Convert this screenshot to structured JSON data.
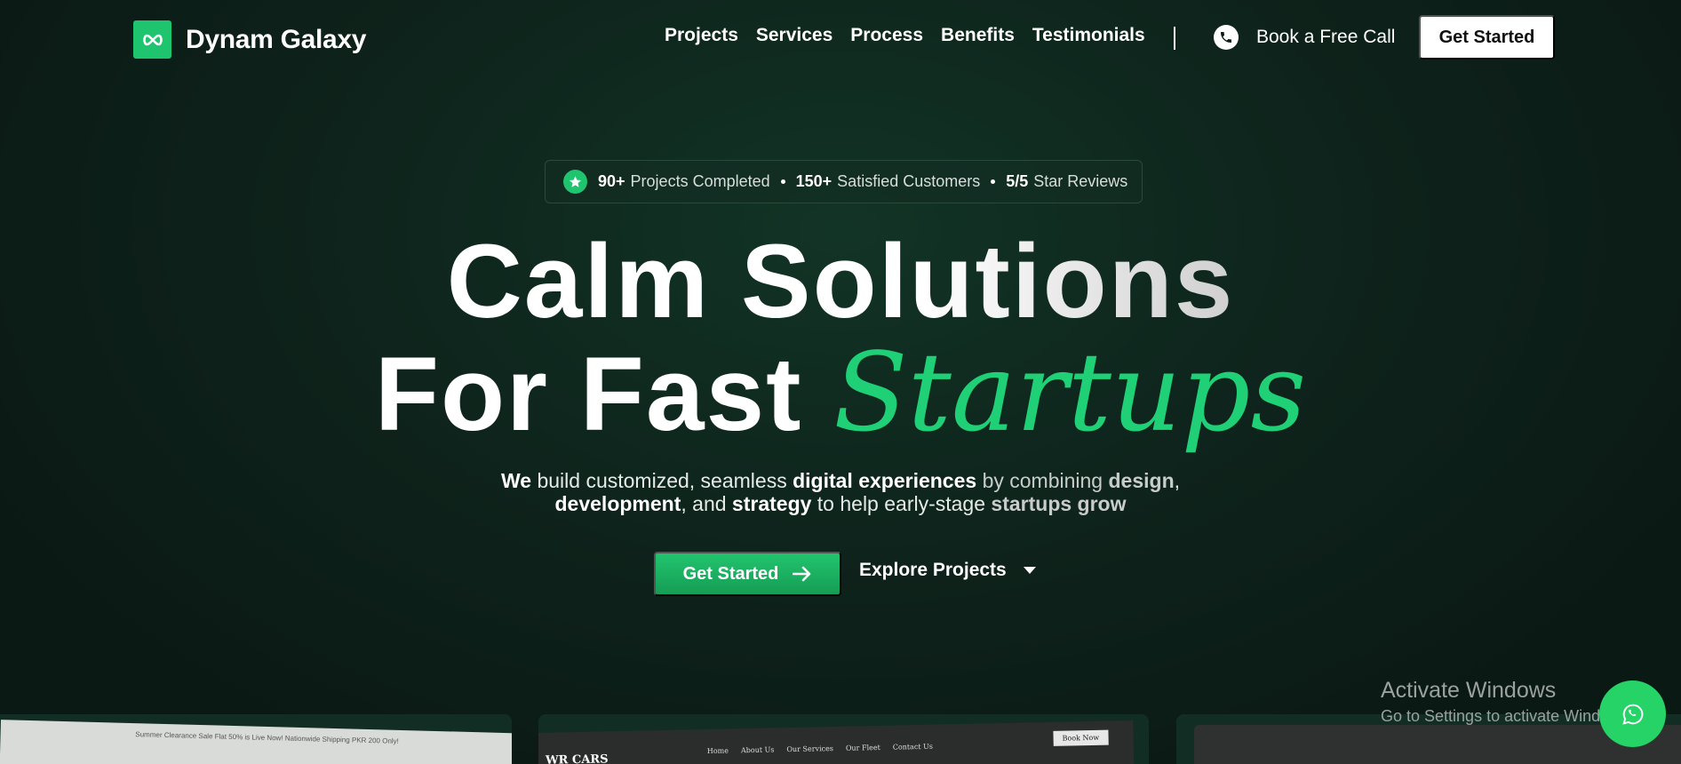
{
  "brand": {
    "name": "Dynam Galaxy",
    "logo_icon": "infinity-icon",
    "accent_color": "#1fc46f"
  },
  "nav": {
    "items": [
      {
        "label": "Projects"
      },
      {
        "label": "Services"
      },
      {
        "label": "Process"
      },
      {
        "label": "Benefits"
      },
      {
        "label": "Testimonials"
      }
    ],
    "call_label": "Book a Free Call",
    "call_icon": "phone-icon",
    "cta_label": "Get Started"
  },
  "stats": {
    "icon": "star-icon",
    "items": [
      {
        "num": "90+",
        "text": "Projects Completed"
      },
      {
        "num": "150+",
        "text": "Satisfied Customers"
      },
      {
        "num": "5/5",
        "text": "Star Reviews"
      }
    ]
  },
  "hero": {
    "line1": "Calm Solutions",
    "line2_plain": "For Fast ",
    "line2_accent": "Startups",
    "sub": {
      "p1_b": "We",
      "p1": " build customized, seamless ",
      "p2_b": "digital experiences",
      "p2": " by combining ",
      "p3_b": "design",
      "p3": ",",
      "p4_b": "development",
      "p4": ", and ",
      "p5_b": "strategy",
      "p5": " to help early-stage ",
      "p6_b": "startups grow"
    },
    "primary_cta": "Get Started",
    "secondary_cta": "Explore Projects"
  },
  "previews": {
    "card1_banner": "Summer Clearance Sale Flat 50% is Live Now! Nationwide Shipping PKR 200 Only!",
    "card2": {
      "brand": "WR CARS",
      "links": [
        "Home",
        "About Us",
        "Our Services",
        "Our Fleet",
        "Contact Us"
      ],
      "book": "Book Now"
    }
  },
  "watermark": {
    "title": "Activate Windows",
    "sub": "Go to Settings to activate Windows."
  },
  "whatsapp_icon": "whatsapp-icon"
}
